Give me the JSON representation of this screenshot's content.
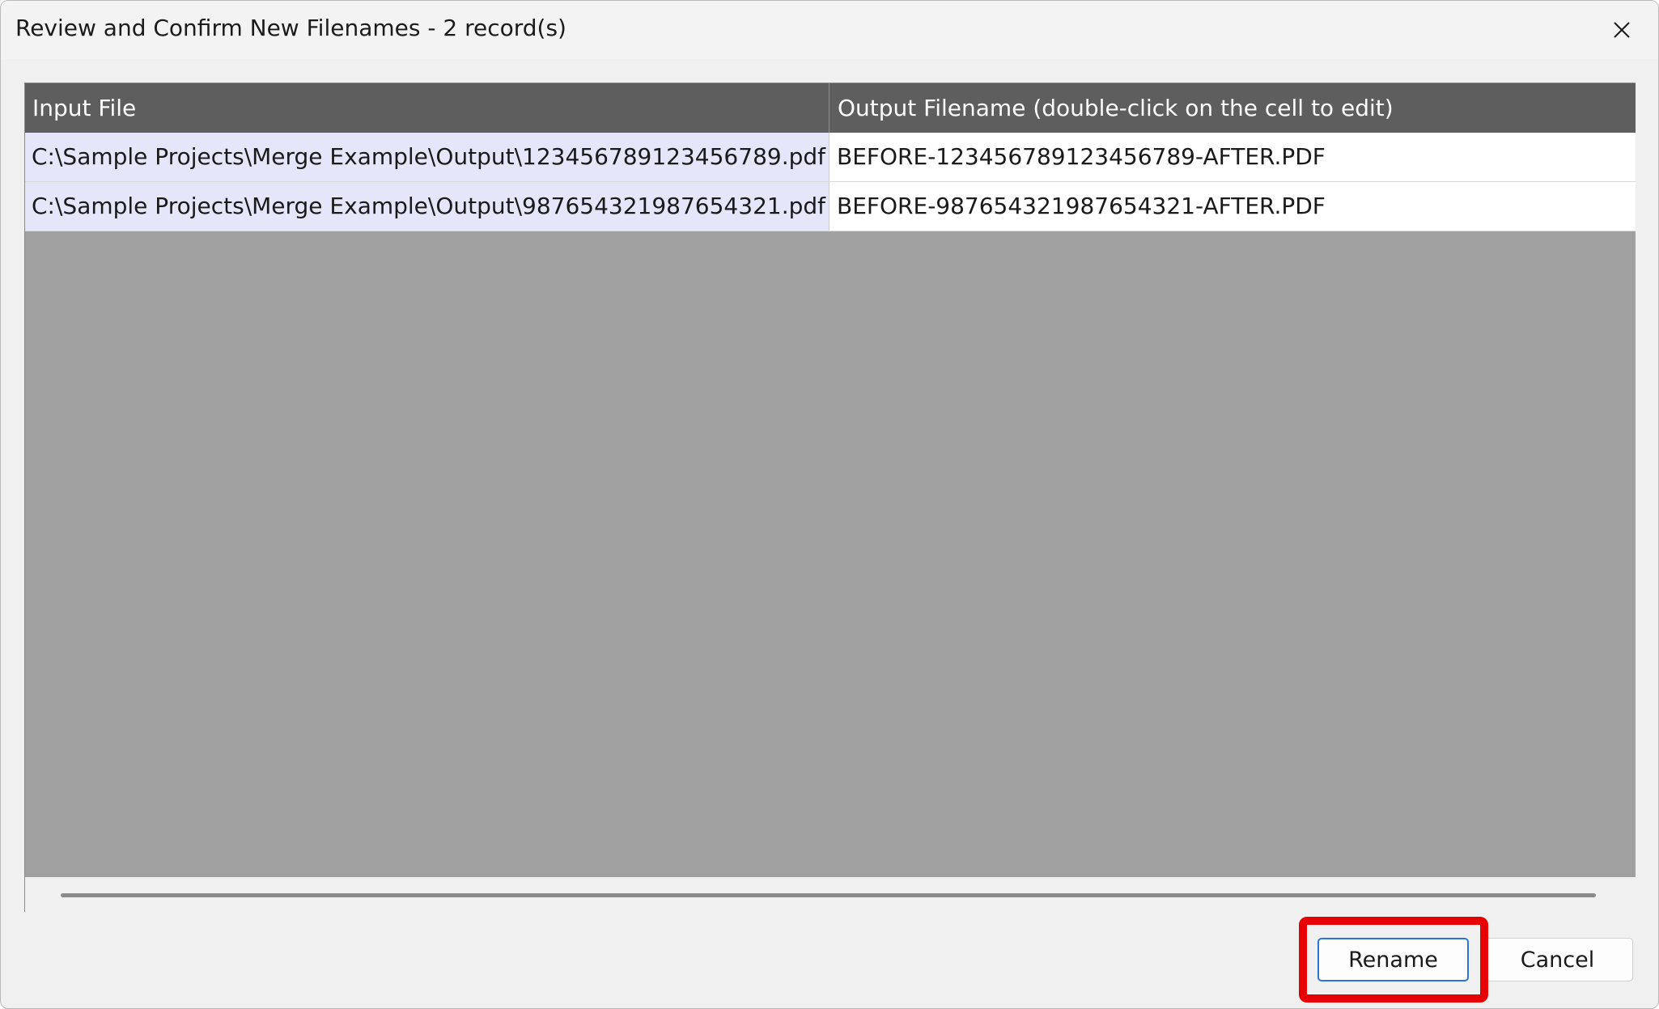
{
  "window": {
    "title": "Review and Confirm New Filenames - 2 record(s)",
    "close_icon": "close-icon"
  },
  "grid": {
    "columns": [
      "Input File",
      "Output Filename (double-click on the cell to edit)"
    ],
    "rows": [
      {
        "input": "C:\\Sample Projects\\Merge Example\\Output\\123456789123456789.pdf",
        "output": "BEFORE-123456789123456789-AFTER.PDF"
      },
      {
        "input": "C:\\Sample Projects\\Merge Example\\Output\\987654321987654321.pdf",
        "output": "BEFORE-987654321987654321-AFTER.PDF"
      }
    ]
  },
  "buttons": {
    "rename": "Rename",
    "cancel": "Cancel"
  },
  "colors": {
    "header_bg": "#5e5e5e",
    "input_cell_bg": "#e6e6fa",
    "grid_empty_bg": "#a0a0a0",
    "highlight": "#e60000",
    "focus_border": "#2b73d4"
  }
}
